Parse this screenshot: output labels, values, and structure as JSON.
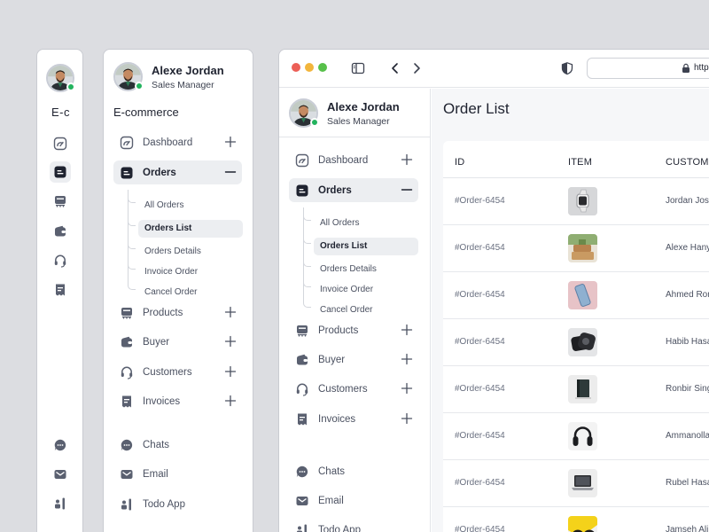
{
  "profile": {
    "name": "Alexe Jordan",
    "role": "Sales Manager"
  },
  "brand": "E-commerce",
  "rail": {
    "brand_short": "E-c",
    "icons": [
      "dashboard-icon",
      "orders-icon",
      "products-icon",
      "buyer-icon",
      "customers-icon",
      "invoices-icon",
      "chats-icon",
      "email-icon",
      "todo-icon"
    ]
  },
  "nav": {
    "items": [
      {
        "label": "Dashboard",
        "icon": "dashboard-icon",
        "toggle": "+"
      },
      {
        "label": "Orders",
        "icon": "orders-icon",
        "toggle": "−",
        "active": true
      },
      {
        "label": "Products",
        "icon": "products-icon",
        "toggle": "+"
      },
      {
        "label": "Buyer",
        "icon": "buyer-icon",
        "toggle": "+"
      },
      {
        "label": "Customers",
        "icon": "customers-icon",
        "toggle": "+"
      },
      {
        "label": "Invoices",
        "icon": "invoices-icon",
        "toggle": "+"
      }
    ],
    "sub_items": [
      "All Orders",
      "Orders List",
      "Orders Details",
      "Invoice Order",
      "Cancel Order"
    ],
    "active_sub": "Orders List",
    "apps": [
      {
        "label": "Chats",
        "icon": "chats-icon"
      },
      {
        "label": "Email",
        "icon": "email-icon"
      },
      {
        "label": "Todo App",
        "icon": "todo-icon"
      }
    ]
  },
  "browser": {
    "url_partial": "https"
  },
  "main": {
    "title": "Order List",
    "columns": [
      "ID",
      "ITEM",
      "CUSTOME"
    ],
    "rows": [
      {
        "id": "#Order-6454",
        "item": "smartwatch",
        "customer": "Jordan Jos"
      },
      {
        "id": "#Order-6454",
        "item": "wooden-boxes",
        "customer": "Alexe Hany"
      },
      {
        "id": "#Order-6454",
        "item": "smartphone",
        "customer": "Ahmed Ron"
      },
      {
        "id": "#Order-6454",
        "item": "camera-bag",
        "customer": "Habib Hasa"
      },
      {
        "id": "#Order-6454",
        "item": "book",
        "customer": "Ronbir Sing"
      },
      {
        "id": "#Order-6454",
        "item": "headphones",
        "customer": "Ammanolla"
      },
      {
        "id": "#Order-6454",
        "item": "laptop",
        "customer": "Rubel Hasa"
      },
      {
        "id": "#Order-6454",
        "item": "sunglasses",
        "customer": "Jamseh Ali"
      }
    ]
  },
  "colors": {
    "accent": "#1f2330",
    "online": "#22b35e",
    "active_bg": "#eceef1",
    "page_bg": "#dcdde1"
  }
}
